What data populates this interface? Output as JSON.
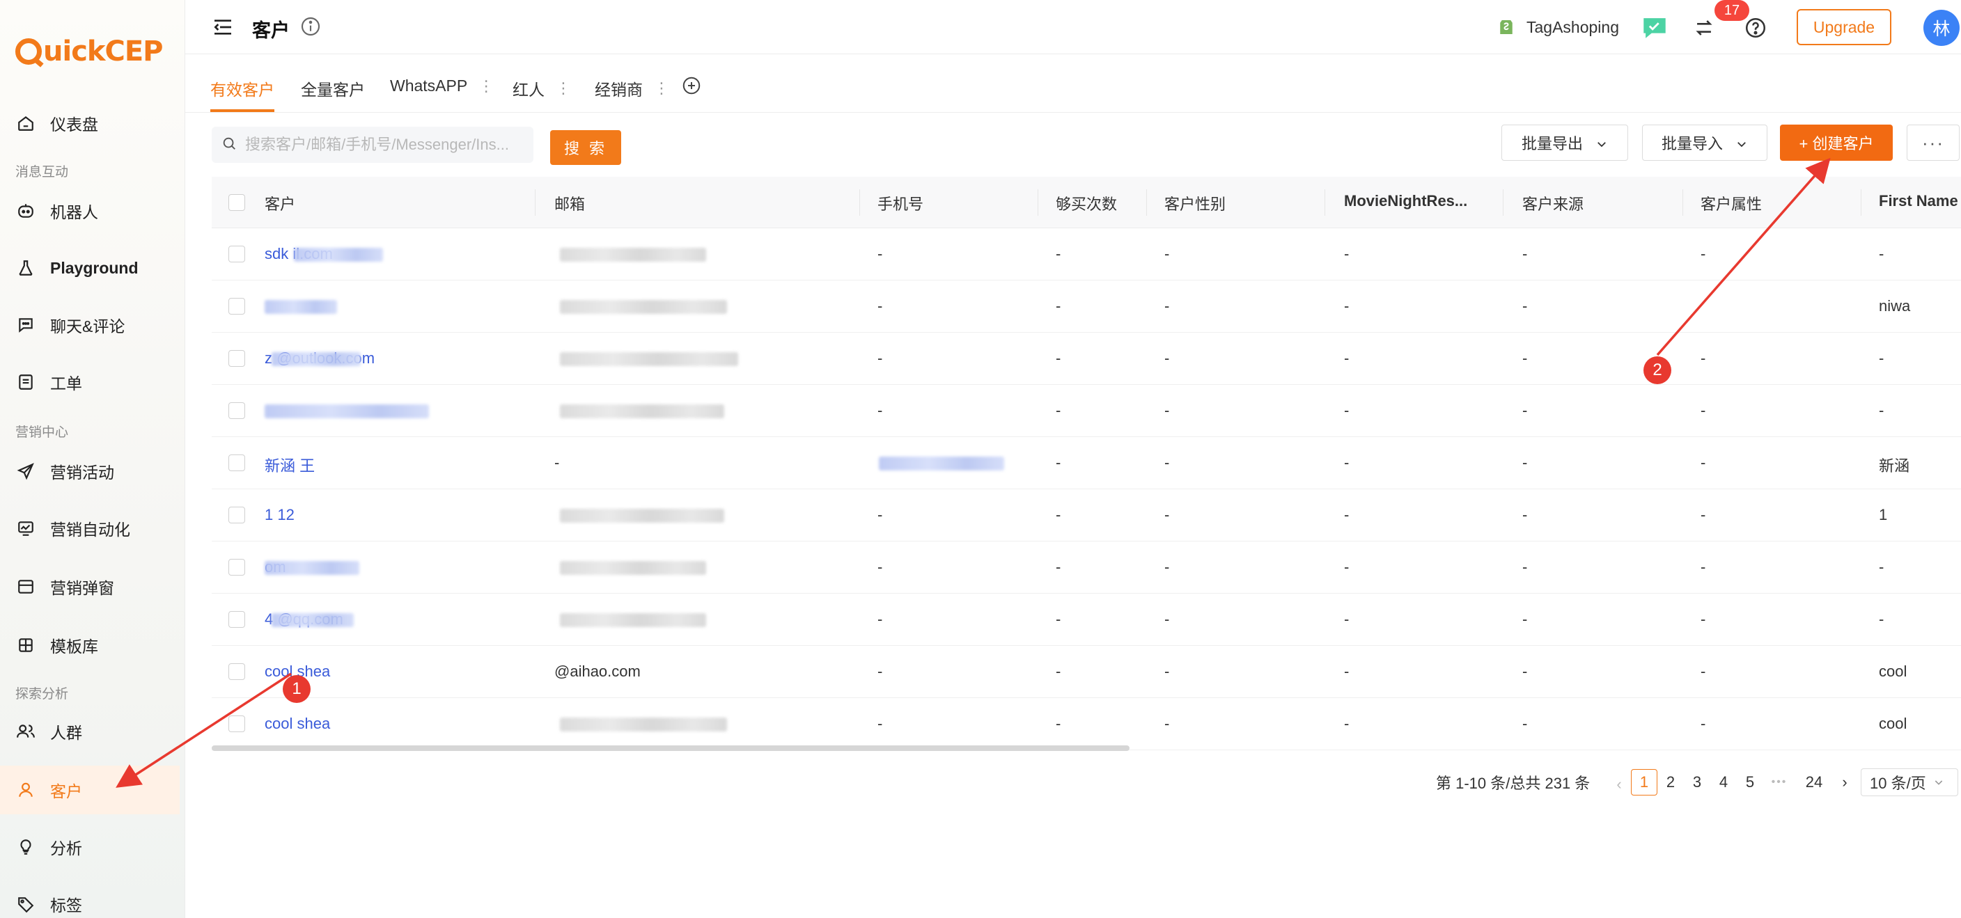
{
  "app": {
    "logo_text": "uickCEP",
    "brand_color": "#f27a1a"
  },
  "sidebar": {
    "items": [
      {
        "label": "仪表盘",
        "icon": "home-icon"
      },
      {
        "label": "机器人",
        "icon": "robot-icon"
      },
      {
        "label": "Playground",
        "icon": "flask-icon"
      },
      {
        "label": "聊天&评论",
        "icon": "chat-icon"
      },
      {
        "label": "工单",
        "icon": "ticket-icon"
      },
      {
        "label": "营销活动",
        "icon": "send-icon"
      },
      {
        "label": "营销自动化",
        "icon": "automation-icon"
      },
      {
        "label": "营销弹窗",
        "icon": "popup-icon"
      },
      {
        "label": "模板库",
        "icon": "template-icon"
      },
      {
        "label": "人群",
        "icon": "users-icon"
      },
      {
        "label": "客户",
        "icon": "user-icon"
      },
      {
        "label": "分析",
        "icon": "bulb-icon"
      },
      {
        "label": "标签",
        "icon": "tag-icon"
      }
    ],
    "sections": [
      "消息互动",
      "营销中心",
      "探索分析"
    ],
    "active": "客户"
  },
  "header": {
    "title": "客户",
    "shop_name": "TagAshoping",
    "notification_count": "17",
    "upgrade_label": "Upgrade",
    "avatar_text": "林"
  },
  "tabs": [
    {
      "label": "有效客户",
      "active": true
    },
    {
      "label": "全量客户"
    },
    {
      "label": "WhatsAPP"
    },
    {
      "label": "红人"
    },
    {
      "label": "经销商"
    }
  ],
  "toolbar": {
    "search_placeholder": "搜索客户/邮箱/手机号/Messenger/Ins...",
    "search_label": "搜 索",
    "export_label": "批量导出",
    "import_label": "批量导入",
    "create_label": "+ 创建客户",
    "more_label": "···"
  },
  "table": {
    "columns": [
      "客户",
      "邮箱",
      "手机号",
      "够买次数",
      "客户性别",
      "MovieNightRes...",
      "客户来源",
      "客户属性",
      "First Name"
    ],
    "rows": [
      {
        "customer": "sdk          il.com",
        "phone": "-",
        "count": "-",
        "gender": "-",
        "movie": "-",
        "source": "-",
        "attr": "-",
        "first": "-"
      },
      {
        "customer": "",
        "phone": "-",
        "count": "-",
        "gender": "-",
        "movie": "-",
        "source": "-",
        "attr": "",
        "first": "niwa"
      },
      {
        "customer": "z          @outlook.com",
        "phone": "-",
        "count": "-",
        "gender": "-",
        "movie": "-",
        "source": "-",
        "attr": "-",
        "first": "-"
      },
      {
        "customer": "",
        "phone": "-",
        "count": "-",
        "gender": "-",
        "movie": "-",
        "source": "-",
        "attr": "-",
        "first": "-"
      },
      {
        "customer": "新涵 王",
        "email": "-",
        "phone": "",
        "count": "-",
        "gender": "-",
        "movie": "-",
        "source": "-",
        "attr": "-",
        "first": "新涵"
      },
      {
        "customer": "1 12",
        "phone": "-",
        "count": "-",
        "gender": "-",
        "movie": "-",
        "source": "-",
        "attr": "-",
        "first": "1"
      },
      {
        "customer": "           om",
        "phone": "-",
        "count": "-",
        "gender": "-",
        "movie": "-",
        "source": "-",
        "attr": "-",
        "first": "-"
      },
      {
        "customer": "4         @qq.com",
        "phone": "-",
        "count": "-",
        "gender": "-",
        "movie": "-",
        "source": "-",
        "attr": "-",
        "first": "-"
      },
      {
        "customer": "cool shea",
        "email": "         @aihao.com",
        "phone": "-",
        "count": "-",
        "gender": "-",
        "movie": "-",
        "source": "-",
        "attr": "-",
        "first": "cool"
      },
      {
        "customer": "cool shea",
        "phone": "-",
        "count": "-",
        "gender": "-",
        "movie": "-",
        "source": "-",
        "attr": "-",
        "first": "cool"
      }
    ]
  },
  "pagination": {
    "summary": "第 1-10 条/总共 231 条",
    "pages": [
      "1",
      "2",
      "3",
      "4",
      "5",
      "•••",
      "24"
    ],
    "current": "1",
    "page_size": "10 条/页"
  },
  "annotations": {
    "marker1": "1",
    "marker2": "2",
    "color": "#e8392f"
  }
}
